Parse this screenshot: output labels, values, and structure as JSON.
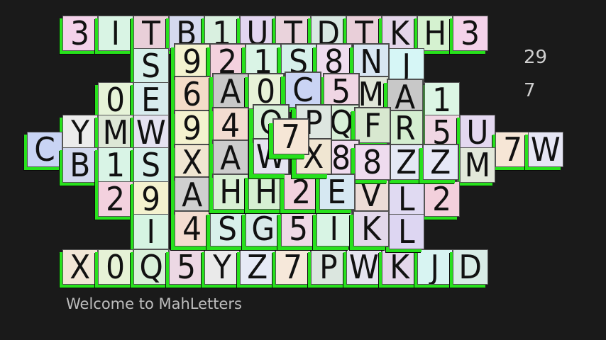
{
  "app": {
    "title": "MahLetters"
  },
  "hud": {
    "pairs_left": "29",
    "level": "7"
  },
  "status": {
    "message": "Welcome to MahLetters"
  },
  "colors": {
    "background": "#1a1a1a",
    "tile_edge": "#27e11c",
    "text": "#111111",
    "hud_text": "#cfcfcf"
  },
  "tiles": {
    "layer1": [
      {
        "ch": "3",
        "bg": "#f4d2ea"
      },
      {
        "ch": "I",
        "bg": "#d9f4e4"
      },
      {
        "ch": "T",
        "bg": "#e9cfd9"
      },
      {
        "ch": "B",
        "bg": "#d5d9ee"
      },
      {
        "ch": "1",
        "bg": "#d9f0e0"
      },
      {
        "ch": "U",
        "bg": "#e2d5f0"
      },
      {
        "ch": "T",
        "bg": "#ead3dc"
      },
      {
        "ch": "D",
        "bg": "#d8e8e2"
      },
      {
        "ch": "T",
        "bg": "#e9cfd9"
      },
      {
        "ch": "K",
        "bg": "#e4d6ea"
      },
      {
        "ch": "H",
        "bg": "#d5f2d0"
      },
      {
        "ch": "3",
        "bg": "#f4d2ea"
      },
      {
        "ch": "S",
        "bg": "#d6f0ea"
      },
      {
        "ch": "0",
        "bg": "#e6f3d8"
      },
      {
        "ch": "E",
        "bg": "#d8ecee"
      },
      {
        "ch": "Y",
        "bg": "#ececec"
      },
      {
        "ch": "M",
        "bg": "#dde7d6"
      },
      {
        "ch": "W",
        "bg": "#e4e2f0"
      },
      {
        "ch": "C",
        "bg": "#c9d4f4"
      },
      {
        "ch": "B",
        "bg": "#d2d8ee"
      },
      {
        "ch": "1",
        "bg": "#d9f4e6"
      },
      {
        "ch": "S",
        "bg": "#d6f0ea"
      },
      {
        "ch": "2",
        "bg": "#f3d1de"
      },
      {
        "ch": "9",
        "bg": "#f4f2cf"
      },
      {
        "ch": "I",
        "bg": "#d6f4e2"
      },
      {
        "ch": "X",
        "bg": "#f1e6d6"
      },
      {
        "ch": "0",
        "bg": "#e6f2d6"
      },
      {
        "ch": "Q",
        "bg": "#d8f0d8"
      },
      {
        "ch": "5",
        "bg": "#ecd8e4"
      },
      {
        "ch": "Y",
        "bg": "#eaeaea"
      },
      {
        "ch": "Z",
        "bg": "#e6eaf6"
      },
      {
        "ch": "7",
        "bg": "#f6e8da"
      },
      {
        "ch": "P",
        "bg": "#dbe6df"
      },
      {
        "ch": "W",
        "bg": "#e6e4f0"
      },
      {
        "ch": "K",
        "bg": "#e4d6ea"
      },
      {
        "ch": "J",
        "bg": "#d8f4f2"
      },
      {
        "ch": "D",
        "bg": "#d8ece6"
      },
      {
        "ch": "J",
        "bg": "#d6f6f6"
      },
      {
        "ch": "1",
        "bg": "#dcf6e4"
      },
      {
        "ch": "5",
        "bg": "#f0d6e4"
      },
      {
        "ch": "U",
        "bg": "#e4d8f0"
      },
      {
        "ch": "7",
        "bg": "#f6e6d6"
      },
      {
        "ch": "W",
        "bg": "#e6e6f4"
      },
      {
        "ch": "M",
        "bg": "#e2e8da"
      },
      {
        "ch": "2",
        "bg": "#f3d0dc"
      },
      {
        "ch": "L",
        "bg": "#e0daf2"
      },
      {
        "ch": "L",
        "bg": "#ddd6f2"
      }
    ],
    "layer2": [
      {
        "ch": "9",
        "bg": "#f4f2cf"
      },
      {
        "ch": "2",
        "bg": "#f3d1de"
      },
      {
        "ch": "1",
        "bg": "#daf4e6"
      },
      {
        "ch": "S",
        "bg": "#d6f0ea"
      },
      {
        "ch": "8",
        "bg": "#efdcef"
      },
      {
        "ch": "N",
        "bg": "#d8e6f2"
      },
      {
        "ch": "6",
        "bg": "#f4dcc8"
      },
      {
        "ch": "M",
        "bg": "#e0e6d8"
      },
      {
        "ch": "A",
        "bg": "#c8c8c8"
      },
      {
        "ch": "9",
        "bg": "#f4f2cf"
      },
      {
        "ch": "R",
        "bg": "#d4eed0"
      },
      {
        "ch": "X",
        "bg": "#f0e6d2"
      },
      {
        "ch": "Z",
        "bg": "#e4e8f4"
      },
      {
        "ch": "Z",
        "bg": "#e6e8f6"
      },
      {
        "ch": "A",
        "bg": "#cfcfcf"
      },
      {
        "ch": "V",
        "bg": "#ecdcd6"
      },
      {
        "ch": "4",
        "bg": "#f4dcd0"
      },
      {
        "ch": "S",
        "bg": "#d8f0ea"
      },
      {
        "ch": "G",
        "bg": "#d8eaea"
      },
      {
        "ch": "5",
        "bg": "#efdae6"
      },
      {
        "ch": "I",
        "bg": "#d8f4e4"
      },
      {
        "ch": "K",
        "bg": "#e2d8ea"
      }
    ],
    "layer3": [
      {
        "ch": "A",
        "bg": "#c8c8c8"
      },
      {
        "ch": "0",
        "bg": "#e8f2d8"
      },
      {
        "ch": "5",
        "bg": "#f0d6e4"
      },
      {
        "ch": "4",
        "bg": "#f2dcd0"
      },
      {
        "ch": "Q",
        "bg": "#d8f0d8"
      },
      {
        "ch": "F",
        "bg": "#d8e8d0"
      },
      {
        "ch": "A",
        "bg": "#cccccc"
      },
      {
        "ch": "8",
        "bg": "#efdcef"
      },
      {
        "ch": "8",
        "bg": "#efdcef"
      },
      {
        "ch": "H",
        "bg": "#d8f0d4"
      },
      {
        "ch": "H",
        "bg": "#d6f0d2"
      },
      {
        "ch": "2",
        "bg": "#f2d2de"
      },
      {
        "ch": "E",
        "bg": "#d6e8f2"
      }
    ],
    "layer4": [
      {
        "ch": "C",
        "bg": "#cad4f4"
      },
      {
        "ch": "Q",
        "bg": "#d8f0d8"
      },
      {
        "ch": "P",
        "bg": "#dde6e0"
      },
      {
        "ch": "W",
        "bg": "#e4e4f0"
      },
      {
        "ch": "X",
        "bg": "#f0e6d2"
      }
    ],
    "top": [
      {
        "ch": "7",
        "bg": "#f6e6d6"
      }
    ]
  }
}
